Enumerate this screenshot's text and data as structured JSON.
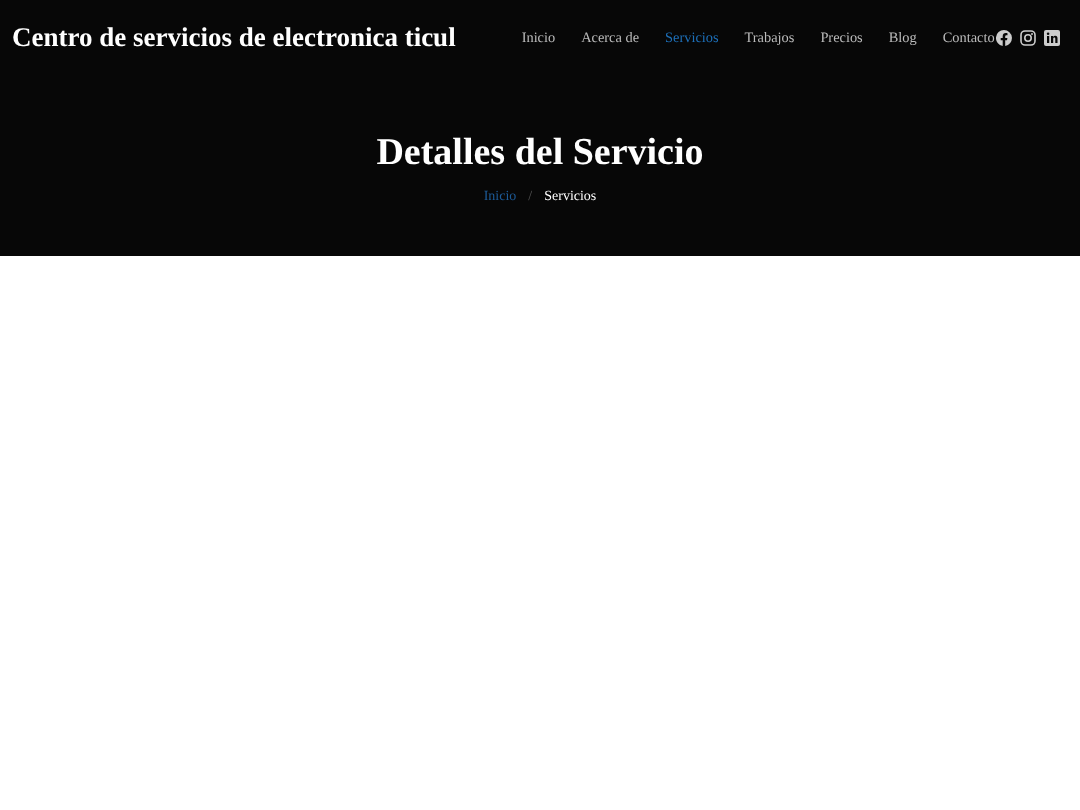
{
  "header": {
    "brand": "Centro de servicios de electronica ticul",
    "nav": [
      {
        "label": "Inicio",
        "selected": false
      },
      {
        "label": "Acerca de",
        "selected": false
      },
      {
        "label": "Servicios",
        "selected": true
      },
      {
        "label": "Trabajos",
        "selected": false
      },
      {
        "label": "Precios",
        "selected": false
      },
      {
        "label": "Blog",
        "selected": false
      },
      {
        "label": "Contacto",
        "selected": false
      }
    ]
  },
  "hero": {
    "title": "Detalles del Servicio",
    "breadcrumb": {
      "separator": "/",
      "items": [
        {
          "label": "Inicio",
          "kind": "link"
        },
        {
          "label": "Servicios",
          "kind": "current"
        }
      ]
    }
  }
}
